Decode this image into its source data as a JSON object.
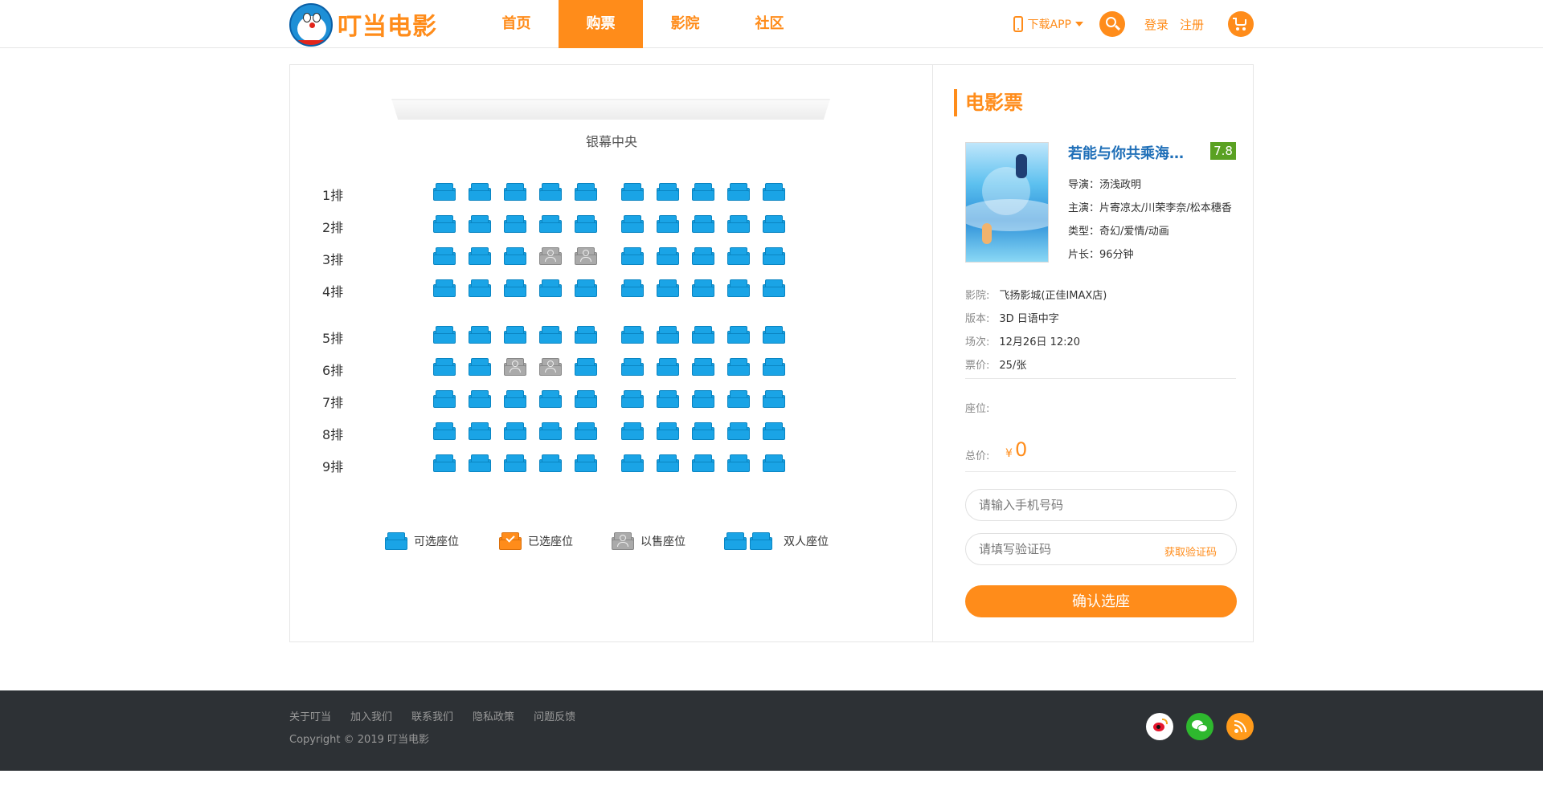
{
  "header": {
    "logo_text": "叮当电影",
    "nav": [
      {
        "label": "首页",
        "active": false
      },
      {
        "label": "购票",
        "active": true
      },
      {
        "label": "影院",
        "active": false
      },
      {
        "label": "社区",
        "active": false
      }
    ],
    "download_label": "下载APP",
    "login_label": "登录",
    "register_label": "注册"
  },
  "seatmap": {
    "screen_label": "银幕中央",
    "rows": [
      {
        "label": "1排",
        "sold": []
      },
      {
        "label": "2排",
        "sold": []
      },
      {
        "label": "3排",
        "sold": [
          4,
          5
        ]
      },
      {
        "label": "4排",
        "sold": []
      },
      {
        "label": "5排",
        "sold": []
      },
      {
        "label": "6排",
        "sold": [
          3,
          4
        ]
      },
      {
        "label": "7排",
        "sold": []
      },
      {
        "label": "8排",
        "sold": []
      },
      {
        "label": "9排",
        "sold": []
      }
    ],
    "seats_per_row": 10,
    "legend": {
      "available": "可选座位",
      "selected": "已选座位",
      "sold": "以售座位",
      "double": "双人座位"
    }
  },
  "ticket": {
    "title": "电影票",
    "movie_name": "若能与你共乘海浪之上",
    "score": "7.8",
    "director_label": "导演：",
    "director": "汤浅政明",
    "cast_label": "主演：",
    "cast": "片寄凉太/川荣李奈/松本穗香",
    "genre_label": "类型：",
    "genre": "奇幻/爱情/动画",
    "length_label": "片长：",
    "length": "96分钟",
    "cinema_label": "影院:",
    "cinema": "飞扬影城(正佳IMAX店)",
    "version_label": "版本:",
    "version": "3D 日语中字",
    "session_label": "场次:",
    "session": "12月26日 12:20",
    "price_label": "票价:",
    "price": "25/张",
    "seat_label": "座位:",
    "total_label": "总价:",
    "currency": "¥",
    "total": "0",
    "phone_placeholder": "请输入手机号码",
    "code_placeholder": "请填写验证码",
    "get_code_label": "获取验证码",
    "confirm_label": "确认选座"
  },
  "footer": {
    "links": [
      "关于叮当",
      "加入我们",
      "联系我们",
      "隐私政策",
      "问题反馈"
    ],
    "copyright": "Copyright © 2019 叮当电影"
  }
}
